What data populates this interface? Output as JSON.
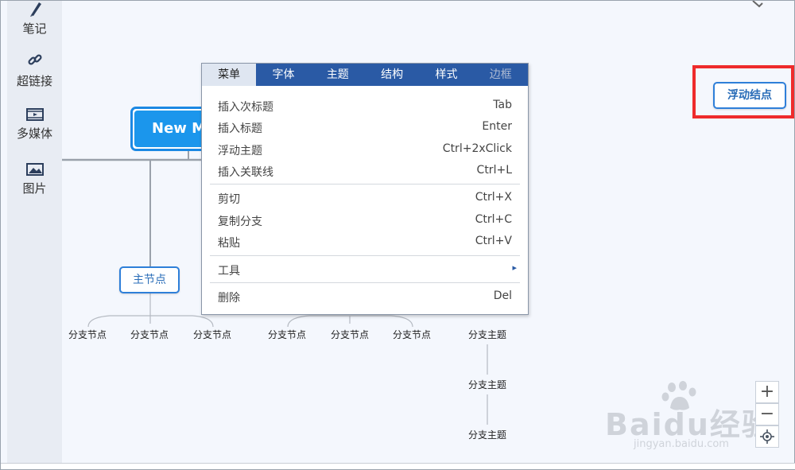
{
  "sidebar": {
    "items": [
      {
        "label": "笔记",
        "icon": "pencil-icon"
      },
      {
        "label": "超链接",
        "icon": "link-icon"
      },
      {
        "label": "多媒体",
        "icon": "film-icon"
      },
      {
        "label": "图片",
        "icon": "image-icon"
      }
    ]
  },
  "canvas": {
    "central_topic": "New Map",
    "main_node": "主节点",
    "floating_node": "浮动结点",
    "left_leaves": [
      "分支节点",
      "分支节点",
      "分支节点"
    ],
    "middle_leaves": [
      "分支节点",
      "分支节点",
      "分支节点"
    ],
    "right_branch": [
      "分支主题",
      "分支主题",
      "分支主题"
    ]
  },
  "context_menu": {
    "tabs": [
      {
        "label": "菜单",
        "state": "active"
      },
      {
        "label": "字体",
        "state": "normal"
      },
      {
        "label": "主题",
        "state": "normal"
      },
      {
        "label": "结构",
        "state": "normal"
      },
      {
        "label": "样式",
        "state": "normal"
      },
      {
        "label": "边框",
        "state": "disabled"
      }
    ],
    "items": [
      {
        "label": "插入次标题",
        "shortcut": "Tab"
      },
      {
        "label": "插入标题",
        "shortcut": "Enter"
      },
      {
        "label": "浮动主题",
        "shortcut": "Ctrl+2xClick"
      },
      {
        "label": "插入关联线",
        "shortcut": "Ctrl+L"
      },
      {
        "label": "剪切",
        "shortcut": "Ctrl+X"
      },
      {
        "label": "复制分支",
        "shortcut": "Ctrl+C"
      },
      {
        "label": "粘贴",
        "shortcut": "Ctrl+V"
      },
      {
        "label": "工具",
        "shortcut": "▸"
      },
      {
        "label": "删除",
        "shortcut": "Del"
      }
    ]
  },
  "zoom": {
    "zoom_in": "+",
    "zoom_out": "−",
    "locate_icon": "crosshair-icon"
  },
  "watermark": {
    "main": "Baidu经验",
    "sub": "jingyan.baidu.com"
  },
  "colors": {
    "menu_tab_bar": "#2a5aa5",
    "central_fill": "#1b96ec",
    "node_border": "#2e7fd9",
    "highlight": "#ee2b2b"
  }
}
